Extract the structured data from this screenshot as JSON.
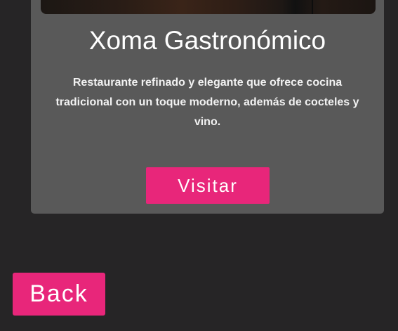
{
  "card": {
    "title": "Xoma Gastronómico",
    "description": "Restaurante refinado y elegante que ofrece cocina tradicional con un toque moderno, además de cocteles y vino.",
    "visit_label": "Visitar"
  },
  "back_label": "Back",
  "colors": {
    "page_background": "#262526",
    "card_background": "#595959",
    "accent": "#e8267a",
    "text": "#ffffff"
  }
}
